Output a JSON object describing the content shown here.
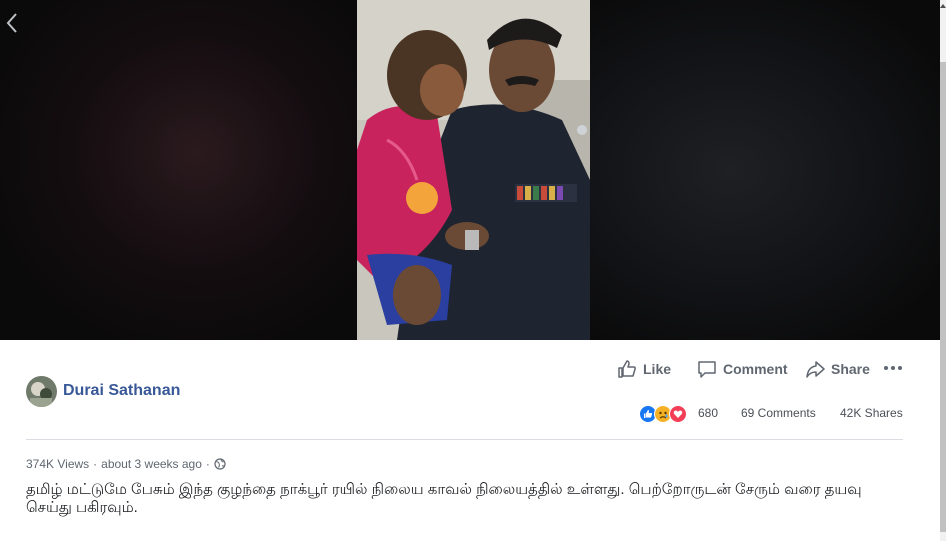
{
  "post": {
    "author_name": "Durai Sathanan",
    "views": "374K Views",
    "separator": "·",
    "time": "about 3 weeks ago",
    "caption": "தமிழ் மட்டுமே பேசும் இந்த குழந்தை நாக்பூர் ரயில் நிலைய காவல் நிலையத்தில் உள்ளது. பெற்றோருடன் சேரும் வரை தயவு செய்து பகிரவும்."
  },
  "actions": {
    "like_label": "Like",
    "comment_label": "Comment",
    "share_label": "Share"
  },
  "stats": {
    "reaction_count": "680",
    "comments": "69 Comments",
    "shares": "42K Shares"
  },
  "reactions": [
    "like",
    "sad",
    "love"
  ],
  "colors": {
    "link_blue": "#385898",
    "like_blue": "#1877f2",
    "love_red": "#f33e58",
    "sad_yellow": "#f7b125",
    "theater_bg": "#0d0d0d"
  },
  "icons": [
    "chevron-left-icon",
    "thumbs-up-icon",
    "comment-icon",
    "share-icon",
    "more-icon",
    "globe-icon"
  ]
}
